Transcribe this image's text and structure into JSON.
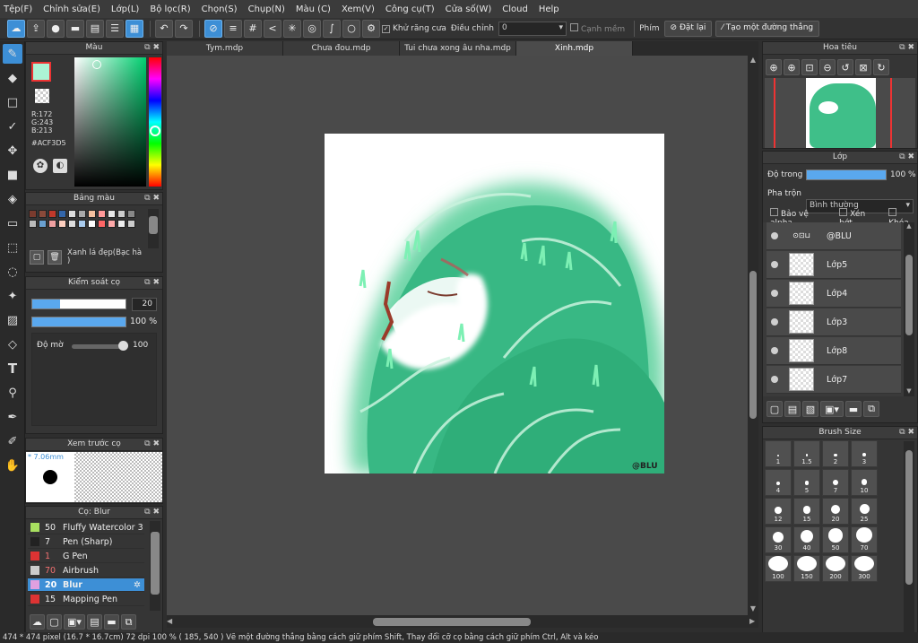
{
  "menu": [
    "Tệp(F)",
    "Chỉnh sửa(E)",
    "Lớp(L)",
    "Bộ lọc(R)",
    "Chọn(S)",
    "Chụp(N)",
    "Màu (C)",
    "Xem(V)",
    "Công cụ(T)",
    "Cửa số(W)",
    "Cloud",
    "Help"
  ],
  "toolbar": {
    "antialias_label": "Khử răng cưa",
    "adjust_label": "Điều chỉnh",
    "adjust_value": "0",
    "soft_edge_label": "Cạnh mềm",
    "key_label": "Phím",
    "reset_label": "Đặt lại",
    "straight_line_label": "Tạo một đường thẳng"
  },
  "tabs": [
    "Tym.mdp",
    "Chưa đou.mdp",
    "Tui chưa xong âu nha.mdp",
    "Xinh.mdp"
  ],
  "color_panel": {
    "title": "Màu",
    "r": "R:172",
    "g": "G:243",
    "b": "B:213",
    "hex": "#ACF3D5",
    "current": "#ACF3D5"
  },
  "palette_panel": {
    "title": "Bảng màu",
    "swatches": [
      "#7a3b2e",
      "#8a4a3a",
      "#c0392b",
      "#3366aa",
      "#dddddd",
      "#aaaaaa",
      "#f5c0a0",
      "#ff9999",
      "#e8e8e8",
      "#cccccc",
      "#888888",
      "#bbbbbb",
      "#6aa0d0",
      "#f0a0a0",
      "#ffd0c0",
      "#dddddd",
      "#aaccee",
      "#ffffff",
      "#ff6666",
      "#ffaaaa",
      "#eeeeee",
      "#cccccc"
    ],
    "palette_name": "Xanh lá đẹp(Bạc hà\n)"
  },
  "brush_control": {
    "title": "Kiểm soát cọ",
    "size": "20",
    "opacity": "100 %",
    "density_label": "Độ mờ",
    "density_value": "100",
    "size_fraction": 0.3,
    "opacity_fraction": 1.0
  },
  "brush_preview": {
    "title": "Xem trước cọ",
    "size_label": "* 7.06mm"
  },
  "brush_list": {
    "title": "Cọ: Blur",
    "items": [
      {
        "size": "50",
        "name": "Fluffy Watercolor 3",
        "color": "#a8e060"
      },
      {
        "size": "7",
        "name": "Pen (Sharp)",
        "color": "#222222"
      },
      {
        "size": "1",
        "name": "G Pen",
        "color": "#dd3333"
      },
      {
        "size": "70",
        "name": "Airbrush",
        "color": "#cccccc"
      },
      {
        "size": "20",
        "name": "Blur",
        "color": "#e0a0e0",
        "active": true
      },
      {
        "size": "15",
        "name": "Mapping Pen",
        "color": "#dd3333"
      }
    ]
  },
  "navigator": {
    "title": "Hoa tiêu"
  },
  "layers_panel": {
    "title": "Lớp",
    "opacity_label": "Độ trong",
    "opacity_value": "100 %",
    "blend_label": "Pha trộn",
    "blend_value": "Bình thường",
    "protect_alpha": "Bảo vệ alpha",
    "clipping": "Xén bớt",
    "lock": "Khóa",
    "layers": [
      "@BLU",
      "Lớp5",
      "Lớp4",
      "Lớp3",
      "Lớp8",
      "Lớp7"
    ]
  },
  "brush_size_panel": {
    "title": "Brush Size",
    "sizes": [
      "1",
      "1.5",
      "2",
      "3",
      "4",
      "5",
      "7",
      "10",
      "12",
      "15",
      "20",
      "25",
      "30",
      "40",
      "50",
      "70",
      "100",
      "150",
      "200",
      "300"
    ]
  },
  "canvas": {
    "signature": "@BLU"
  },
  "status": "474 * 474 pixel  (16.7 * 16.7cm)  72 dpi  100 %  ( 185, 540 )  Vẽ một đường thẳng bằng cách giữ phím Shift, Thay đổi cỡ cọ bằng cách giữ phím Ctrl, Alt và kéo"
}
